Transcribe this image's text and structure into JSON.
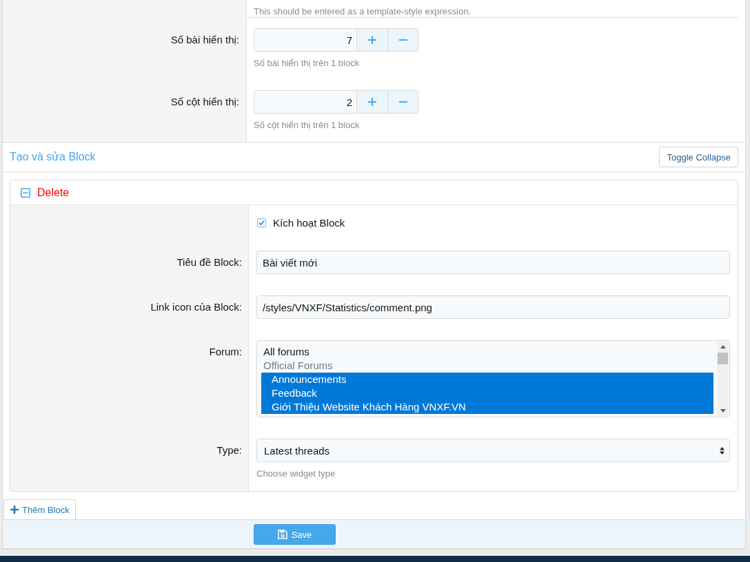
{
  "previous_field": {
    "hint": "This should be entered as a template-style expression."
  },
  "number_fields": [
    {
      "label": "Số bài hiển thị:",
      "value": "7",
      "hint": "Số bài hiển thị trên 1 block"
    },
    {
      "label": "Số cột hiển thị:",
      "value": "2",
      "hint": "Số cột hiển thị trên 1 block"
    }
  ],
  "blocks_section": {
    "title": "Tạo và sửa Block",
    "toggle_button": "Toggle Collapse",
    "blocks": [
      {
        "expanded": true,
        "delete_label": "Delete",
        "fields": [
          {
            "kind": "checkbox",
            "label": "Kích hoạt Block",
            "checked": true
          },
          {
            "kind": "text",
            "label": "Tiêu đề Block:",
            "value": "Bài viết mới"
          },
          {
            "kind": "text",
            "label": "Link icon của Block:",
            "value": "/styles/VNXF/Statistics/comment.png"
          },
          {
            "kind": "listbox",
            "label": "Forum:",
            "options": [
              {
                "kind": "option",
                "label": "All forums",
                "selected": false
              },
              {
                "kind": "group",
                "label": "Official Forums",
                "selected": false,
                "children": [
                  {
                    "kind": "option",
                    "label": "Announcements",
                    "selected": true
                  },
                  {
                    "kind": "option",
                    "label": "Feedback",
                    "selected": true
                  },
                  {
                    "kind": "option",
                    "label": "Giới Thiệu Website Khách Hàng VNXF.VN",
                    "selected": true
                  }
                ]
              }
            ]
          },
          {
            "kind": "select",
            "label": "Type:",
            "value": "Latest threads",
            "hint": "Choose widget type"
          }
        ]
      }
    ],
    "add_button": "Thêm Block"
  },
  "footer": {
    "save_button": "Save"
  }
}
